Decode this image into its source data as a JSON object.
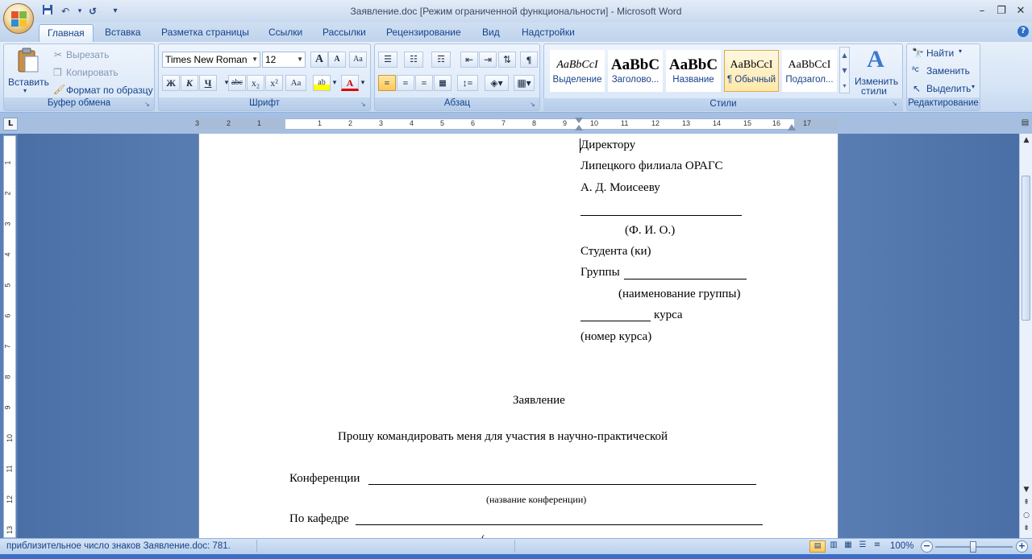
{
  "window": {
    "title": "Заявление.doc [Режим ограниченной функциональности] - Microsoft Word",
    "min": "–",
    "max": "❐",
    "close": "✕"
  },
  "qat": {
    "save": "💾",
    "undo": "↶",
    "redo": "↺",
    "more": "▾"
  },
  "tabs": [
    "Главная",
    "Вставка",
    "Разметка страницы",
    "Ссылки",
    "Рассылки",
    "Рецензирование",
    "Вид",
    "Надстройки"
  ],
  "help": "?",
  "clipboard": {
    "paste": "Вставить",
    "cut": "Вырезать",
    "copy": "Копировать",
    "format_painter": "Формат по образцу",
    "label": "Буфер обмена"
  },
  "font": {
    "name": "Times New Roman",
    "size": "12",
    "grow": "A",
    "shrink": "A",
    "clear": "Aa",
    "bold": "Ж",
    "italic": "К",
    "underline": "Ч",
    "strike": "abc",
    "sub": "x₂",
    "sup": "x²",
    "case": "Aa",
    "highlight": "ab",
    "color": "A",
    "label": "Шрифт"
  },
  "paragraph": {
    "label": "Абзац",
    "pilcrow": "¶"
  },
  "styles": {
    "items": [
      {
        "preview": "AaBbCcI",
        "name": "Выделение"
      },
      {
        "preview": "AaBbC",
        "name": "Заголово..."
      },
      {
        "preview": "AaBbC",
        "name": "Название"
      },
      {
        "preview": "AaBbCcI",
        "name": "¶ Обычный"
      },
      {
        "preview": "AaBbCcI",
        "name": "Подзагол..."
      }
    ],
    "change": "Изменить",
    "change2": "стили",
    "label": "Стили"
  },
  "editing": {
    "find": "Найти",
    "replace": "Заменить",
    "select": "Выделить",
    "label": "Редактирование"
  },
  "ruler": {
    "left": [
      "3",
      "2",
      "1"
    ],
    "right": [
      "1",
      "2",
      "3",
      "4",
      "5",
      "6",
      "7",
      "8",
      "9",
      "10",
      "11",
      "12",
      "13",
      "14",
      "15",
      "16",
      "17"
    ]
  },
  "vruler": [
    "1",
    "2",
    "3",
    "4",
    "5",
    "6",
    "7",
    "8",
    "9",
    "10",
    "11",
    "12",
    "13"
  ],
  "doc": {
    "l1": "Директору",
    "l2": "Липецкого филиала ОРАГС",
    "l3": "А. Д. Моисееву",
    "fio": "(Ф. И. О.)",
    "student": "Студента (ки)",
    "group": "Группы",
    "group_hint": "(наименование группы)",
    "course": "курса",
    "course_hint": "(номер курса)",
    "heading": "Заявление",
    "request": "Прошу командировать меня для участия в научно-практической",
    "conf": "Конференции",
    "conf_hint": "(название конференции)",
    "dept": "По кафедре"
  },
  "status": {
    "text": "приблизительное число знаков Заявление.doc: 781.",
    "zoom": "100%"
  }
}
